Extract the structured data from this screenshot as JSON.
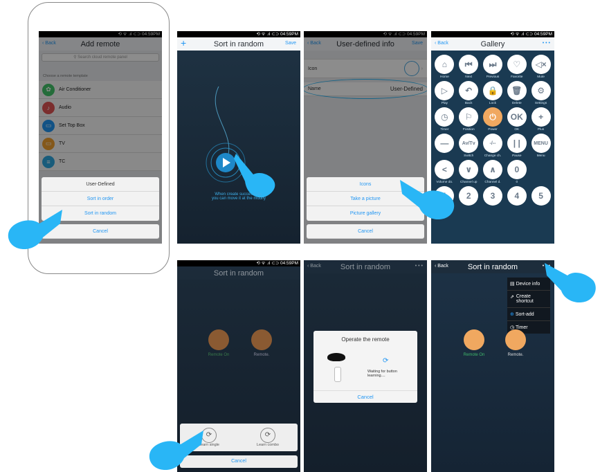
{
  "status_time": "04:59PM",
  "status_icons": "⟲ ᯤ .ıl ⊂⊃",
  "s1": {
    "back": "Back",
    "title": "Add remote",
    "search_placeholder": "Search cloud remote panel",
    "section": "Choose a remote template",
    "templates": [
      "Air Conditioner",
      "Audio",
      "Set Top Box",
      "TV",
      "TC"
    ],
    "sheet_title": "User-Defined",
    "sort_order": "Sort in order",
    "sort_random": "Sort in random",
    "cancel": "Cancel"
  },
  "s2": {
    "add": "+",
    "title": "Sort in random",
    "save": "Save",
    "msg1": "When create successfully,",
    "msg2": "you can move it at the modify"
  },
  "s3": {
    "back": "Back",
    "title": "User-defined info",
    "save": "Save",
    "icon_label": "Icon",
    "name_label": "Name",
    "name_value": "User-Defined",
    "opt_icons": "Icons",
    "opt_picture": "Take a picture",
    "opt_gallery": "Picture gallery",
    "cancel": "Cancel"
  },
  "s4": {
    "back": "Back",
    "title": "Gallery",
    "more": "• • •",
    "buttons": [
      {
        "glyph": "⌂",
        "label": "Home"
      },
      {
        "glyph": "⏮",
        "label": "Next"
      },
      {
        "glyph": "⏭",
        "label": "Previous"
      },
      {
        "glyph": "♡",
        "label": "Favorite"
      },
      {
        "glyph": "◁×",
        "label": "Mute"
      },
      {
        "glyph": "▷",
        "label": "Play"
      },
      {
        "glyph": "↶",
        "label": "Back"
      },
      {
        "glyph": "🔒",
        "label": "Lock"
      },
      {
        "glyph": "🗑",
        "label": "Delete"
      },
      {
        "glyph": "⚙",
        "label": "Settings"
      },
      {
        "glyph": "◷",
        "label": "Timer"
      },
      {
        "glyph": "⚐",
        "label": "Position"
      },
      {
        "glyph": "⏻",
        "label": "Power"
      },
      {
        "glyph": "OK",
        "label": "OK"
      },
      {
        "glyph": "+",
        "label": "Plus"
      },
      {
        "glyph": "—",
        "label": ""
      },
      {
        "glyph": "Av/Tv",
        "label": "Switch"
      },
      {
        "glyph": "-/--",
        "label": "Change ch."
      },
      {
        "glyph": "| |",
        "label": "Pause"
      },
      {
        "glyph": "MENU",
        "label": "Menu"
      },
      {
        "glyph": "<",
        "label": "Volume do."
      },
      {
        "glyph": "∨",
        "label": "Channel up"
      },
      {
        "glyph": "∧",
        "label": "Channel d."
      },
      {
        "glyph": "0",
        "label": "0"
      },
      {
        "glyph": "",
        "label": ""
      },
      {
        "glyph": "1",
        "label": ""
      },
      {
        "glyph": "2",
        "label": ""
      },
      {
        "glyph": "3",
        "label": ""
      },
      {
        "glyph": "4",
        "label": ""
      },
      {
        "glyph": "5",
        "label": ""
      }
    ]
  },
  "s5": {
    "title": "Sort in random",
    "remote_on": "Remote On",
    "remote": "Remote.",
    "learn_single": "Learn single",
    "learn_combo": "Learn combo",
    "cancel": "Cancel"
  },
  "s6": {
    "back": "Back",
    "title": "Sort in random",
    "more": "• • •",
    "dialog_title": "Operate the remote",
    "waiting": "Waiting for button learning....",
    "cancel": "Cancel"
  },
  "s7": {
    "back": "Back",
    "title": "Sort in random",
    "more": "• • •",
    "menu": [
      "Device info",
      "Create shortcut",
      "Sort-add",
      "Timer"
    ],
    "remote_on": "Remote On",
    "remote": "Remote."
  },
  "colors": {
    "accent": "#2196f3",
    "hand": "#29b6f6",
    "dark_bg": "#172434",
    "orange": "#f0a860"
  }
}
